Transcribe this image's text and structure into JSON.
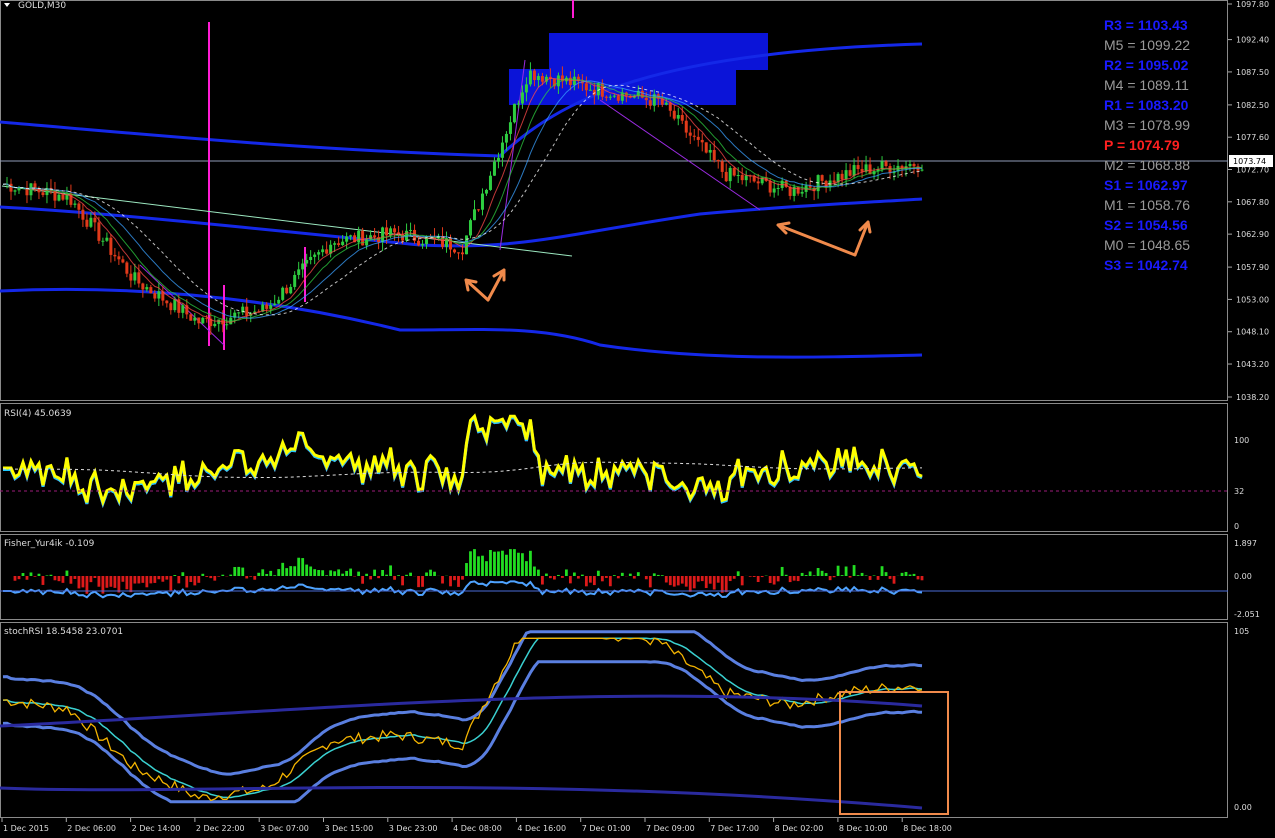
{
  "window": {
    "title": "GOLD,M30",
    "price_tag": "1073.74"
  },
  "panels": {
    "main": {
      "ymin": 1038.2,
      "ymax": 1097.8,
      "ticks": [
        "1097.80",
        "1092.40",
        "1087.50",
        "1082.50",
        "1077.60",
        "1072.70",
        "1067.80",
        "1062.90",
        "1057.90",
        "1053.00",
        "1048.10",
        "1043.20",
        "1038.20"
      ]
    },
    "rsi": {
      "label": "RSI(4) 45.0639",
      "ticks": [
        "100",
        "32",
        "0"
      ]
    },
    "fisher": {
      "label": "Fisher_Yur4ik -0.109",
      "ticks": [
        "1.897",
        "0.00",
        "-2.051"
      ]
    },
    "stoch": {
      "label": "stochRSI 18.5458 23.0701",
      "ticks": [
        "105",
        "0.00"
      ]
    }
  },
  "xaxis": [
    "1 Dec 2015",
    "2 Dec 06:00",
    "2 Dec 14:00",
    "2 Dec 22:00",
    "3 Dec 07:00",
    "3 Dec 15:00",
    "3 Dec 23:00",
    "4 Dec 08:00",
    "4 Dec 16:00",
    "7 Dec 01:00",
    "7 Dec 09:00",
    "7 Dec 17:00",
    "8 Dec 02:00",
    "8 Dec 10:00",
    "8 Dec 18:00"
  ],
  "pivots": [
    {
      "text": "R3 = 1103.43",
      "color": "#1a1aff"
    },
    {
      "text": "M5 = 1099.22",
      "color": "#9a9a9a"
    },
    {
      "text": "R2 = 1095.02",
      "color": "#1a1aff"
    },
    {
      "text": "M4 = 1089.11",
      "color": "#9a9a9a"
    },
    {
      "text": "R1 = 1083.20",
      "color": "#1a1aff"
    },
    {
      "text": "M3 = 1078.99",
      "color": "#9a9a9a"
    },
    {
      "text": "P   = 1074.79",
      "color": "#ff2020"
    },
    {
      "text": "M2 = 1068.88",
      "color": "#9a9a9a"
    },
    {
      "text": "S1 = 1062.97",
      "color": "#1a1aff"
    },
    {
      "text": "M1 = 1058.76",
      "color": "#9a9a9a"
    },
    {
      "text": "S2 = 1054.56",
      "color": "#1a1aff"
    },
    {
      "text": "M0 = 1048.65",
      "color": "#9a9a9a"
    },
    {
      "text": "S3 = 1042.74",
      "color": "#1a1aff"
    }
  ],
  "chart_data": {
    "type": "line",
    "symbol": "GOLD",
    "timeframe": "M30",
    "ylim": [
      1038.2,
      1097.8
    ],
    "x": [
      "1 Dec 2015",
      "2 Dec 06:00",
      "2 Dec 14:00",
      "2 Dec 22:00",
      "3 Dec 07:00",
      "3 Dec 15:00",
      "3 Dec 23:00",
      "4 Dec 08:00",
      "4 Dec 16:00",
      "7 Dec 01:00",
      "7 Dec 09:00",
      "7 Dec 17:00",
      "8 Dec 02:00",
      "8 Dec 10:00",
      "8 Dec 18:00"
    ],
    "series": [
      {
        "values": [
          1070.5,
          1068.6,
          1056.0,
          1049.5,
          1051.5,
          1061.8,
          1063.0,
          1061.0,
          1087.5,
          1085.0,
          1083.0,
          1072.0,
          1069.5,
          1072.5,
          1073.74
        ]
      }
    ],
    "colors": {
      "bull": "#2ecc40",
      "bear": "#e23a1a",
      "envelope": "#1428e8",
      "pivot_p": "#ff2020",
      "rsi": "#ffff00",
      "stoch": "#5a7fe0"
    }
  }
}
